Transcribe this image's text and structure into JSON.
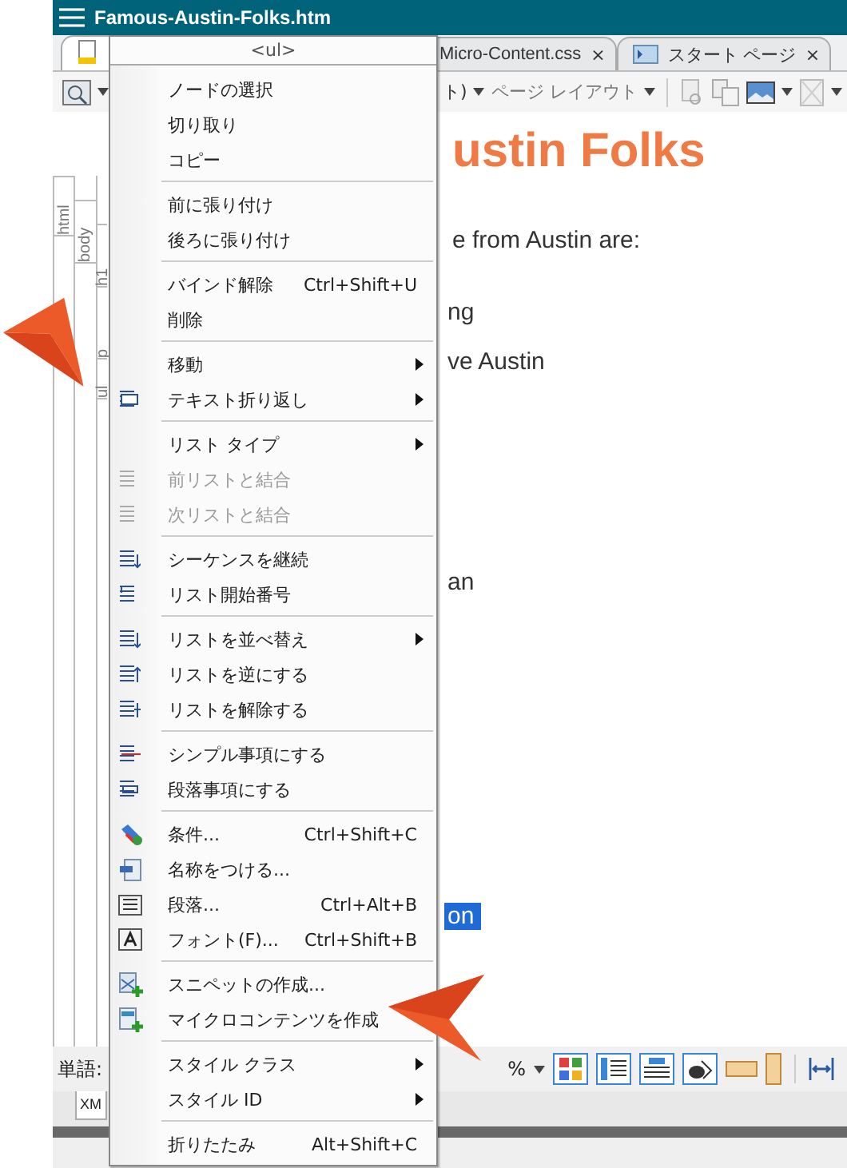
{
  "window": {
    "title": "Famous-Austin-Folks.htm"
  },
  "tabs": [
    {
      "label": "Micro-Content.css",
      "selected": false,
      "close": "×"
    },
    {
      "label": "スタート ページ",
      "selected": false,
      "close": "×"
    }
  ],
  "toolbar": {
    "partial_label": "ト)",
    "layout_label": "ページ レイアウト"
  },
  "breadcrumb": {
    "columns": [
      [
        "html"
      ],
      [
        "body"
      ],
      [
        "h1",
        "p",
        "ul"
      ]
    ]
  },
  "document": {
    "lines": [
      {
        "kind": "heading",
        "text": "ustin Folks"
      },
      {
        "kind": "text",
        "text": "e from Austin are:",
        "selected": false
      },
      {
        "kind": "text",
        "text": "ng",
        "selected": false
      },
      {
        "kind": "text",
        "text": "ve Austin",
        "selected": false
      },
      {
        "kind": "text",
        "text": "an",
        "selected": false
      },
      {
        "kind": "text",
        "text": "on",
        "selected": true
      }
    ]
  },
  "status_bar": {
    "words_label": "単語:",
    "zoom_label": "%"
  },
  "bottom_tabs": [
    {
      "label": "XM"
    }
  ],
  "context_menu": {
    "header": "<ul>",
    "groups": [
      [
        {
          "label": "ノードの選択",
          "disabled": false,
          "submenu": false
        },
        {
          "label": "切り取り",
          "disabled": false,
          "submenu": false
        },
        {
          "label": "コピー",
          "disabled": false,
          "submenu": false
        }
      ],
      [
        {
          "label": "前に張り付け",
          "disabled": false,
          "submenu": false
        },
        {
          "label": "後ろに張り付け",
          "disabled": false,
          "submenu": false
        }
      ],
      [
        {
          "label": "バインド解除",
          "shortcut": "Ctrl+Shift+U",
          "disabled": false,
          "submenu": false
        },
        {
          "label": "削除",
          "disabled": false,
          "submenu": false
        }
      ],
      [
        {
          "label": "移動",
          "disabled": false,
          "submenu": true
        },
        {
          "label": "テキスト折り返し",
          "disabled": false,
          "submenu": true
        }
      ],
      [
        {
          "label": "リスト タイプ",
          "disabled": false,
          "submenu": true
        },
        {
          "label": "前リストと結合",
          "disabled": true,
          "submenu": false
        },
        {
          "label": "次リストと結合",
          "disabled": true,
          "submenu": false
        }
      ],
      [
        {
          "label": "シーケンスを継続",
          "disabled": false,
          "submenu": false
        },
        {
          "label": "リスト開始番号",
          "disabled": false,
          "submenu": false
        }
      ],
      [
        {
          "label": "リストを並べ替え",
          "disabled": false,
          "submenu": true
        },
        {
          "label": "リストを逆にする",
          "disabled": false,
          "submenu": false
        },
        {
          "label": "リストを解除する",
          "disabled": false,
          "submenu": false
        }
      ],
      [
        {
          "label": "シンプル事項にする",
          "disabled": false,
          "submenu": false
        },
        {
          "label": "段落事項にする",
          "disabled": false,
          "submenu": false
        }
      ],
      [
        {
          "label": "条件...",
          "shortcut": "Ctrl+Shift+C",
          "disabled": false,
          "submenu": false
        },
        {
          "label": "名称をつける...",
          "disabled": false,
          "submenu": false
        },
        {
          "label": "段落...",
          "shortcut": "Ctrl+Alt+B",
          "disabled": false,
          "submenu": false
        },
        {
          "label": "フォント(F)...",
          "shortcut": "Ctrl+Shift+B",
          "disabled": false,
          "submenu": false
        }
      ],
      [
        {
          "label": "スニペットの作成...",
          "disabled": false,
          "submenu": false
        },
        {
          "label": "マイクロコンテンツを作成",
          "disabled": false,
          "submenu": false
        }
      ],
      [
        {
          "label": "スタイル クラス",
          "disabled": false,
          "submenu": true
        },
        {
          "label": "スタイル ID",
          "disabled": false,
          "submenu": true
        }
      ],
      [
        {
          "label": "折りたたみ",
          "shortcut": "Alt+Shift+C",
          "disabled": false,
          "submenu": false
        }
      ]
    ]
  }
}
